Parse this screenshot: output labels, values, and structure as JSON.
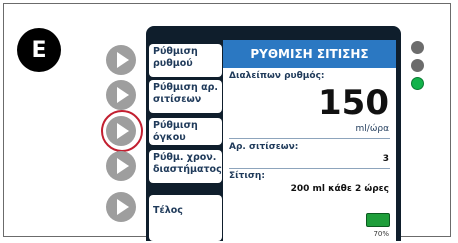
{
  "step": {
    "label": "E"
  },
  "menu": {
    "items": [
      {
        "label": "Ρύθμιση ρυθμού"
      },
      {
        "label": "Ρύθμιση αρ. σιτίσεων"
      },
      {
        "label": "Ρύθμιση όγκου"
      },
      {
        "label": "Ρύθμ. χρον. διαστήματος"
      },
      {
        "label": "Τέλος"
      }
    ],
    "active_index": 2
  },
  "screen": {
    "title": "ΡΥΘΜΙΣΗ ΣΙΤΙΣΗΣ",
    "rate_label": "Διαλείπων ρυθμός:",
    "rate_value": "150",
    "rate_unit": "ml/ώρα",
    "feeds_label": "Αρ. σιτίσεων:",
    "feeds_value": "3",
    "feeding_label": "Σίτιση:",
    "feeding_value": "200 ml κάθε 2 ώρες",
    "battery_percent": "70%"
  },
  "colors": {
    "header": "#2b78c2",
    "device_body": "#0f1e2c",
    "active_ring": "#c21f30",
    "led_on": "#12b24a",
    "led_off": "#6c6c6c"
  },
  "icons": {
    "nav": "play-triangle-icon",
    "battery": "battery-icon",
    "status": "status-led-icon"
  }
}
